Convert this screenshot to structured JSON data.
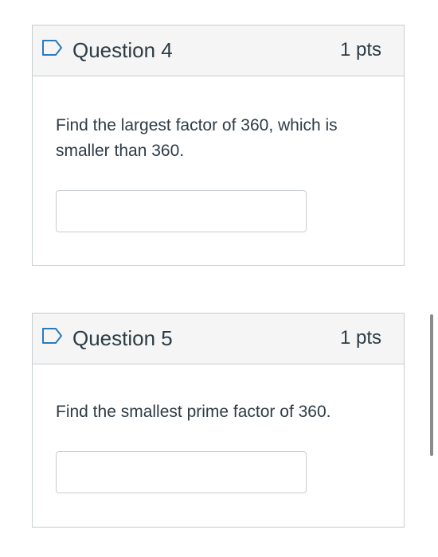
{
  "questions": [
    {
      "title": "Question 4",
      "points": "1 pts",
      "text": "Find the largest factor of 360, which is smaller than 360.",
      "answer_value": "",
      "flag_icon": "flag-outline-icon"
    },
    {
      "title": "Question 5",
      "points": "1 pts",
      "text": "Find the smallest prime factor of 360.",
      "answer_value": "",
      "flag_icon": "flag-outline-icon"
    }
  ],
  "colors": {
    "border": "#c7cdd1",
    "header_bg": "#f5f5f5",
    "text": "#2d3b45",
    "flag": "#2b7abc"
  }
}
